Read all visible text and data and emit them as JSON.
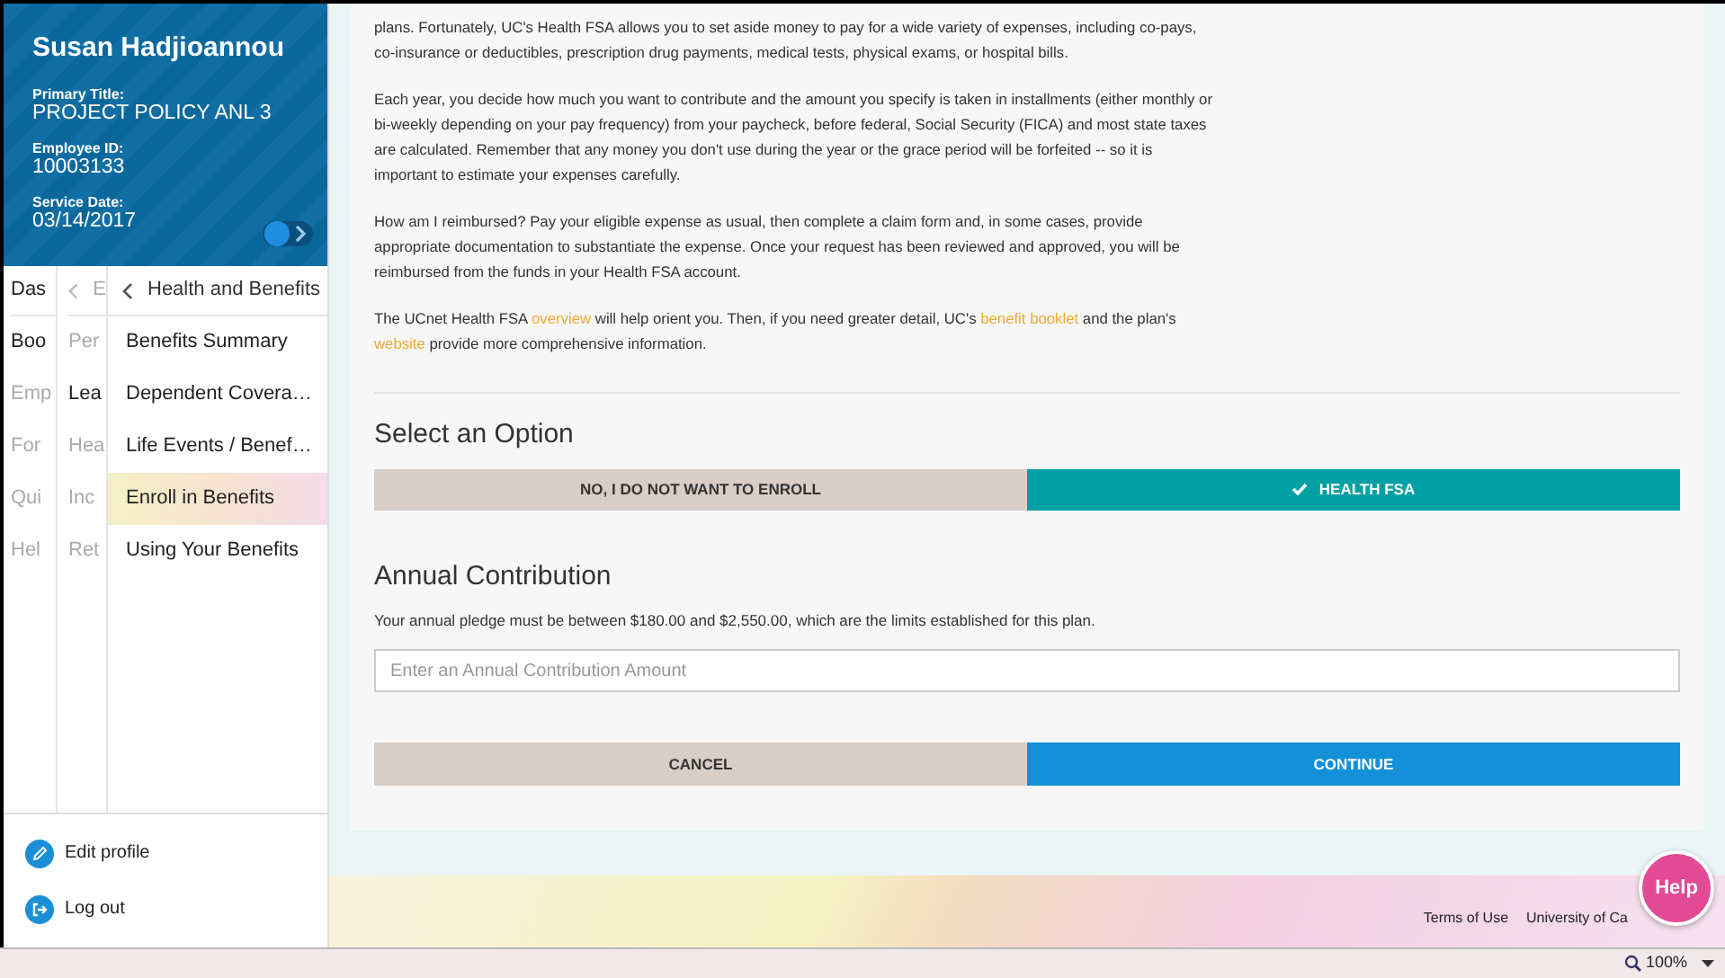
{
  "profile": {
    "name": "Susan Hadjioannou",
    "fields": [
      {
        "label": "Primary Title:",
        "value": "PROJECT POLICY ANL 3"
      },
      {
        "label": "Employee ID:",
        "value": "10003133"
      },
      {
        "label": "Service Date:",
        "value": "03/14/2017"
      }
    ]
  },
  "nav_level_1": [
    {
      "label": "Das",
      "muted": false
    },
    {
      "label": "Boo",
      "muted": false
    },
    {
      "label": "Emp",
      "muted": true
    },
    {
      "label": "For",
      "muted": true
    },
    {
      "label": "Qui",
      "muted": true
    },
    {
      "label": "Hel",
      "muted": true
    }
  ],
  "nav_level_2": {
    "title": "E",
    "items": [
      {
        "label": "Per",
        "muted": true
      },
      {
        "label": "Lea",
        "muted": false
      },
      {
        "label": "Hea",
        "muted": true
      },
      {
        "label": "Inc",
        "muted": true
      },
      {
        "label": "Ret",
        "muted": true
      }
    ]
  },
  "nav_level_3": {
    "title": "Health and Benefits",
    "items": [
      {
        "label": "Benefits Summary",
        "selected": false
      },
      {
        "label": "Dependent Covera…",
        "selected": false
      },
      {
        "label": "Life Events / Benef…",
        "selected": false
      },
      {
        "label": "Enroll in Benefits",
        "selected": true
      },
      {
        "label": "Using Your Benefits",
        "selected": false
      }
    ]
  },
  "sidebar_actions": [
    {
      "label": "Edit profile",
      "kind": "edit"
    },
    {
      "label": "Log out",
      "kind": "logout"
    }
  ],
  "paragraphs": [
    [
      {
        "text": "plans. Fortunately, UC's Health FSA allows you to set aside money to pay for a wide variety of expenses, including co-pays, co-insurance or deductibles, prescription drug payments, medical tests, physical exams, or hospital bills."
      }
    ],
    [
      {
        "text": "Each year, you decide how much you want to contribute and the amount you specify is taken in installments (either monthly or bi-weekly depending on your pay frequency) from your paycheck, before federal, Social Security (FICA) and most state taxes are calculated. Remember that any money you don't use during the year or the grace period will be forfeited -- so it is important to estimate your expenses carefully."
      }
    ],
    [
      {
        "text": "How am I reimbursed? Pay your eligible expense as usual, then complete a claim form and, in some cases, provide appropriate documentation to substantiate the expense. Once your request has been reviewed and approved, you will be reimbursed from the funds in your Health FSA account."
      }
    ],
    [
      {
        "text": "The UCnet Health FSA "
      },
      {
        "link": "overview"
      },
      {
        "text": " will help orient you. Then, if you need greater detail, UC's "
      },
      {
        "link": "benefit booklet"
      },
      {
        "text": " and the plan's "
      },
      {
        "link": "website"
      },
      {
        "text": " provide more comprehensive information."
      }
    ]
  ],
  "select_option": {
    "title": "Select an Option",
    "options": [
      {
        "label": "NO, I DO NOT WANT TO ENROLL",
        "selected": false
      },
      {
        "label": "HEALTH FSA",
        "selected": true
      }
    ]
  },
  "contribution": {
    "title": "Annual Contribution",
    "note": "Your annual pledge must be between $180.00 and $2,550.00, which are the limits established for this plan.",
    "placeholder": "Enter an Annual Contribution Amount"
  },
  "actions": [
    {
      "label": "CANCEL",
      "kind": "secondary"
    },
    {
      "label": "CONTINUE",
      "kind": "primary"
    }
  ],
  "footer": {
    "links": [
      "Terms of Use",
      "University of Ca"
    ]
  },
  "help": "Help",
  "status_bar": {
    "zoom": "100%"
  }
}
